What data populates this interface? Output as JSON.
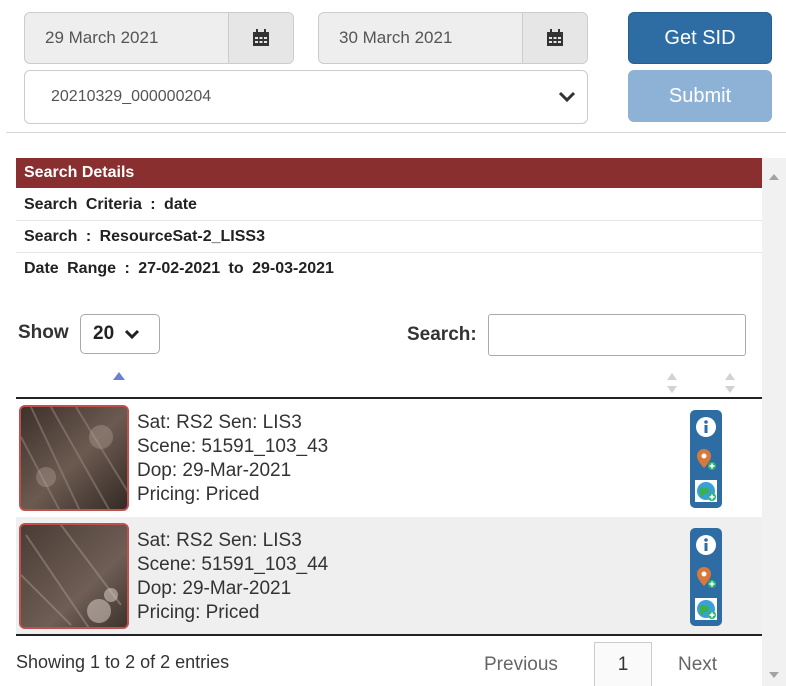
{
  "controls": {
    "from_date": "29 March 2021",
    "to_date": "30 March 2021",
    "sid_value": "20210329_000000204",
    "get_sid_label": "Get SID",
    "submit_label": "Submit"
  },
  "panel": {
    "header": "Search Details",
    "criteria": "Search Criteria : date",
    "resource": "Search : ResourceSat-2_LISS3",
    "date_range": "Date Range : 27-02-2021 to 29-03-2021"
  },
  "table": {
    "show_label": "Show",
    "page_size": "20",
    "search_label": "Search:",
    "search_value": "",
    "rows": [
      {
        "sat": "Sat: RS2 Sen: LIS3",
        "scene": "Scene: 51591_103_43",
        "dop": "Dop: 29-Mar-2021",
        "pricing": "Pricing: Priced"
      },
      {
        "sat": "Sat: RS2 Sen: LIS3",
        "scene": "Scene: 51591_103_44",
        "dop": "Dop: 29-Mar-2021",
        "pricing": "Pricing: Priced"
      }
    ],
    "row_icons": [
      "info-icon",
      "add-location-icon",
      "globe-icon"
    ]
  },
  "footer": {
    "info": "Showing 1 to 2 of 2 entries",
    "previous": "Previous",
    "current_page": "1",
    "next": "Next"
  },
  "colors": {
    "primary": "#2e6da4",
    "header_bg": "#8a2f2f",
    "thumb_border": "#c0504d"
  }
}
